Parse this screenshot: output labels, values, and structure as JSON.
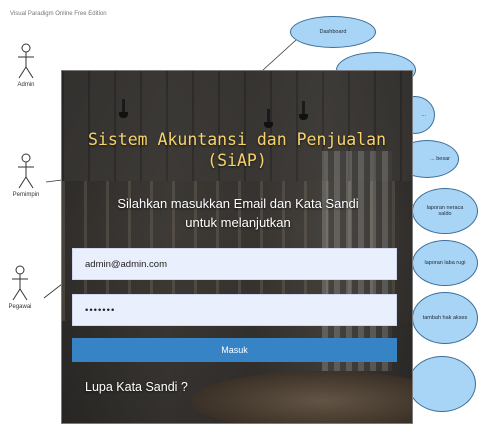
{
  "diagram": {
    "watermark": "Visual Paradigm Online Free Edition",
    "actors": [
      {
        "label": "Admin"
      },
      {
        "label": "Pemimpin"
      },
      {
        "label": "Pegawai"
      }
    ],
    "use_cases": [
      {
        "label": "Dashboard"
      },
      {
        "label": ""
      },
      {
        "label": "..."
      },
      {
        "label": "... besar"
      },
      {
        "label": "laporan neraca saldo"
      },
      {
        "label": "laporan laba rugi"
      },
      {
        "label": "tambah hak akses"
      },
      {
        "label": ""
      }
    ],
    "colors": {
      "use_case_fill": "#a8d4f5",
      "use_case_border": "#3b6e9a"
    }
  },
  "login": {
    "title_line1": "Sistem Akuntansi dan Penjualan",
    "title_line2": "(SiAP)",
    "subtitle_line1": "Silahkan masukkan Email dan Kata Sandi",
    "subtitle_line2": "untuk melanjutkan",
    "email_value": "admin@admin.com",
    "password_value": "•••••••",
    "submit_label": "Masuk",
    "forgot_label": "Lupa Kata Sandi ?",
    "colors": {
      "title": "#f6d36b",
      "button": "#3683c6",
      "input_bg": "#e9effc"
    }
  }
}
